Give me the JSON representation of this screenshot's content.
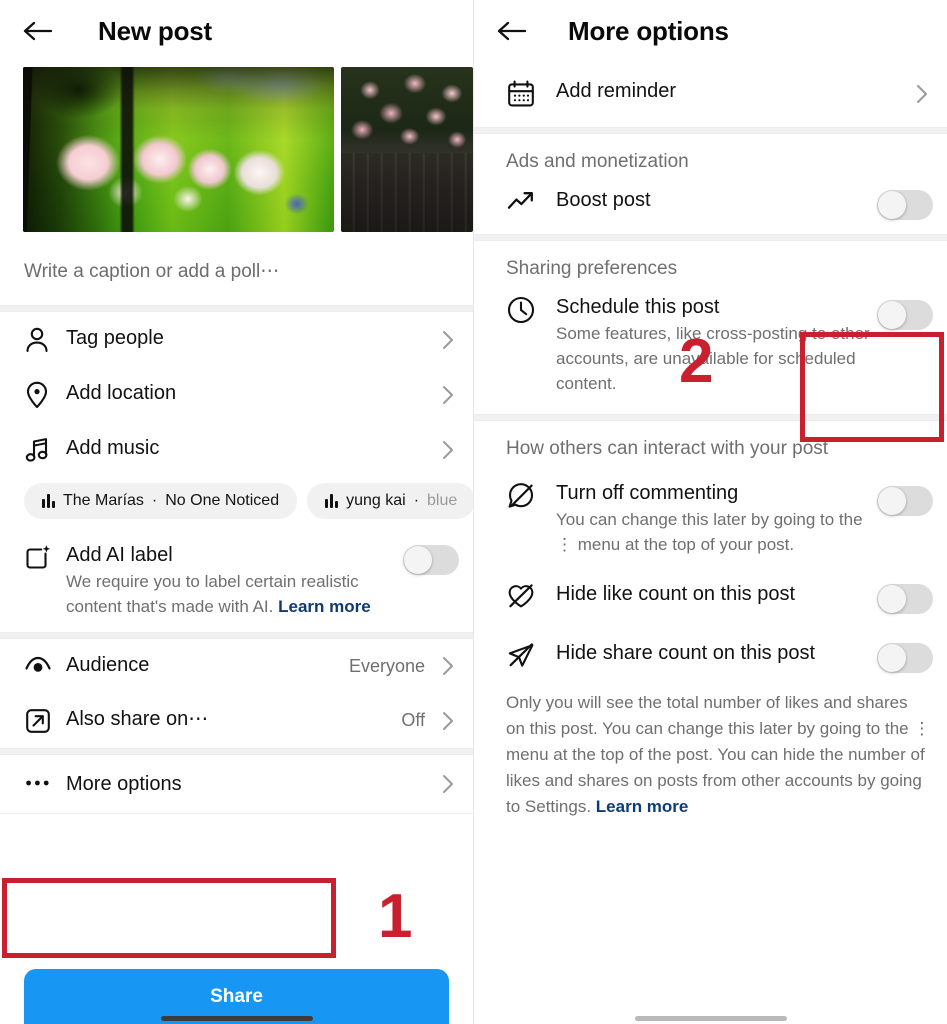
{
  "left_panel": {
    "header": {
      "title": "New post",
      "back_icon": "arrow-left-icon"
    },
    "media": {
      "photo1_alt": "Pale pink tulips and peonies in a sunlit garden",
      "photo2_alt": "Cluster of pink roses on a dark wooden fence"
    },
    "caption_placeholder": "Write a caption or add a poll⋯",
    "rows": [
      {
        "icon": "person-icon",
        "label": "Tag people",
        "value": "",
        "chevron": true
      },
      {
        "icon": "location-pin-icon",
        "label": "Add location",
        "value": "",
        "chevron": true
      },
      {
        "icon": "music-note-icon",
        "label": "Add music",
        "value": "",
        "chevron": true
      }
    ],
    "music_suggestions": [
      {
        "artist": "The Marías",
        "separator": "·",
        "track": "No One Noticed",
        "muted": false
      },
      {
        "artist": "yung kai",
        "separator": "·",
        "track": "blue",
        "muted": true
      }
    ],
    "ai_label": {
      "icon": "ai-sparkle-frame-icon",
      "title": "Add AI label",
      "description": "We require you to label certain realistic content that's made with AI.",
      "link": "Learn more",
      "toggle": "off"
    },
    "bottom_rows": [
      {
        "icon": "eye-icon",
        "label": "Audience",
        "value": "Everyone",
        "chevron": true
      },
      {
        "icon": "share-box-icon",
        "label": "Also share on⋯",
        "value": "Off",
        "chevron": true
      },
      {
        "icon": "ellipsis-icon",
        "label": "More options",
        "value": "",
        "chevron": true
      }
    ],
    "share_button": "Share"
  },
  "right_panel": {
    "header": {
      "title": "More options",
      "back_icon": "arrow-left-icon"
    },
    "reminder_row": {
      "icon": "calendar-icon",
      "label": "Add reminder",
      "chevron": true
    },
    "sections": [
      {
        "title": "Ads and monetization",
        "rows": [
          {
            "icon": "trend-arrow-icon",
            "label": "Boost post",
            "description": "",
            "toggle": "off"
          }
        ]
      },
      {
        "title": "Sharing preferences",
        "rows": [
          {
            "icon": "clock-icon",
            "label": "Schedule this post",
            "description": "Some features, like cross-posting to other accounts, are unavailable for scheduled content.",
            "toggle": "off"
          }
        ]
      },
      {
        "title": "How others can interact with your post",
        "rows": [
          {
            "icon": "comment-off-icon",
            "label": "Turn off commenting",
            "description": "You can change this later by going to the ⋮ menu at the top of your post.",
            "toggle": "off"
          },
          {
            "icon": "heart-off-icon",
            "label": "Hide like count on this post",
            "description": "",
            "toggle": "off"
          },
          {
            "icon": "share-off-icon",
            "label": "Hide share count on this post",
            "description": "",
            "toggle": "off"
          }
        ]
      }
    ],
    "footer_note": "Only you will see the total number of likes and shares on this post. You can change this later by going to the ⋮ menu at the top of the post. You can hide the number of likes and shares on posts from other accounts by going to Settings. ",
    "footer_link": "Learn more"
  },
  "annotations": {
    "step1": "1",
    "step2": "2",
    "color": "#c8202e"
  }
}
